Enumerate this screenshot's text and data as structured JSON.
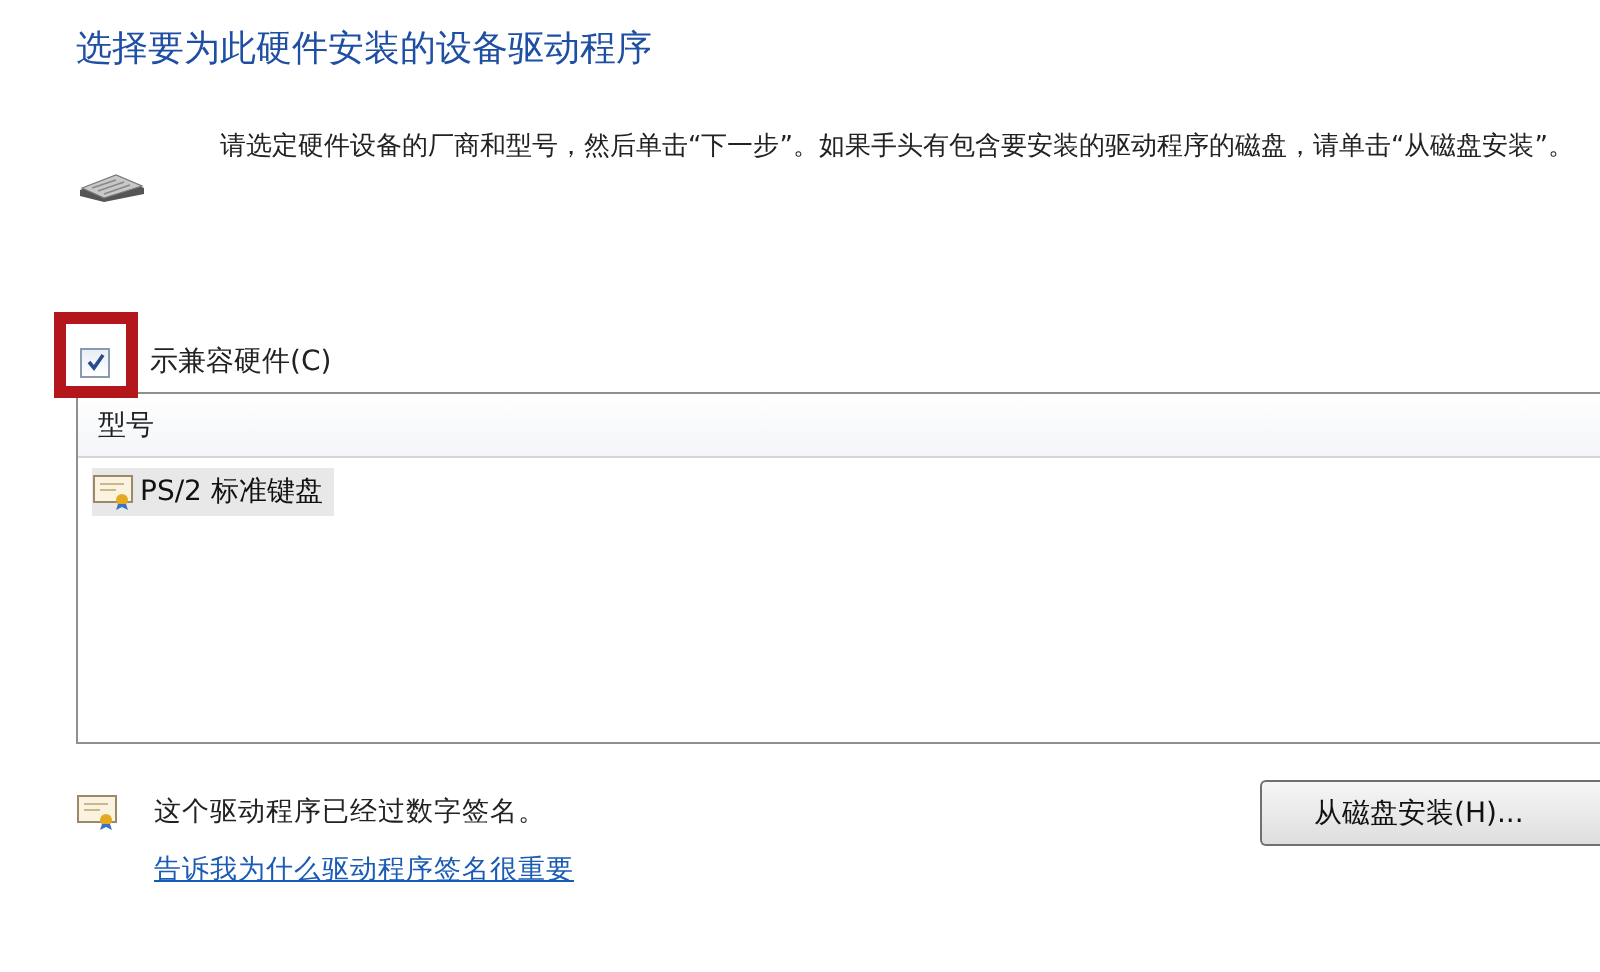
{
  "title": "选择要为此硬件安装的设备驱动程序",
  "instructions": "请选定硬件设备的厂商和型号，然后单击“下一步”。如果手头有包含要安装的驱动程序的磁盘，请单击“从磁盘安装”。",
  "show_compatible": {
    "label": "示兼容硬件(C)",
    "checked": true,
    "highlighted": true
  },
  "model_list": {
    "column": "型号",
    "items": [
      {
        "label": "PS/2 标准键盘",
        "selected": true
      }
    ]
  },
  "signature_note": "这个驱动程序已经过数字签名。",
  "signature_link": "告诉我为什么驱动程序签名很重要",
  "buttons": [
    {
      "kind": "have-disk",
      "label": "从磁盘安装(H)..."
    }
  ]
}
